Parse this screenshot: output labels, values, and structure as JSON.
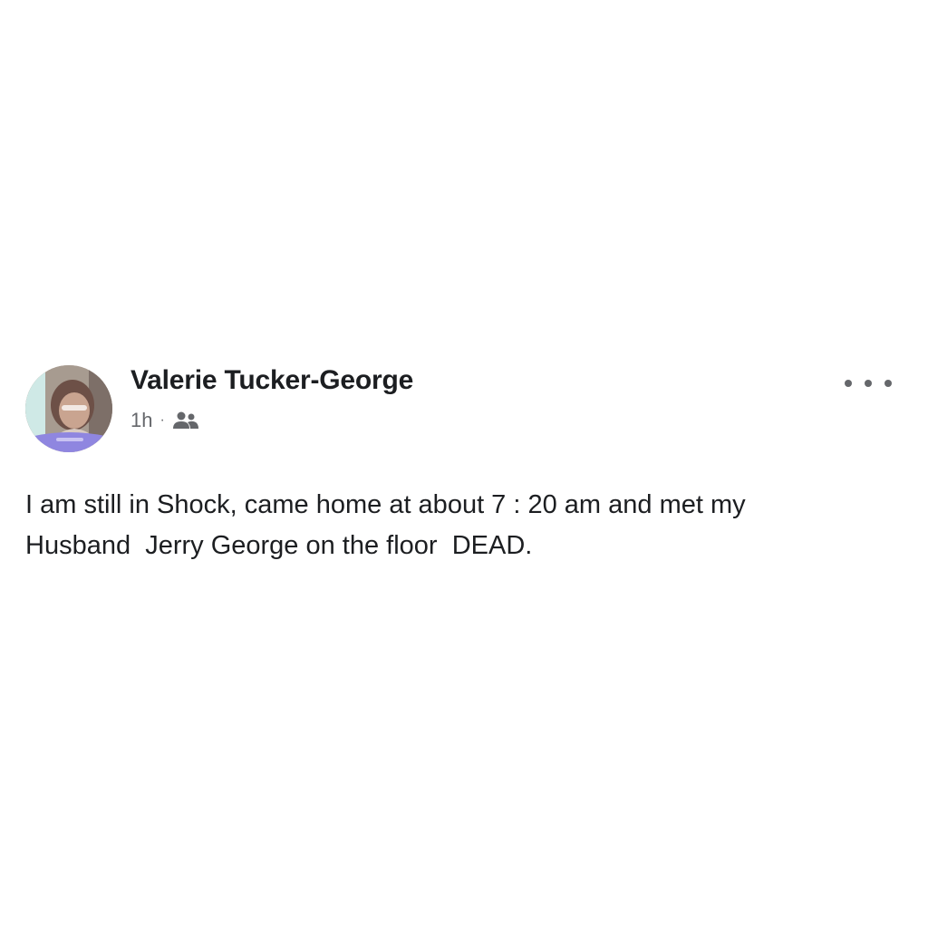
{
  "post": {
    "author": "Valerie Tucker-George",
    "time": "1h",
    "separator": "·",
    "audience_icon": "friends-icon",
    "more_icon": "more-options-icon",
    "text": "I am still in Shock, came home at about 7 : 20 am and met my\nHusband  Jerry George on the floor  DEAD."
  },
  "colors": {
    "text_primary": "#1c1e21",
    "text_secondary": "#65676b",
    "avatar_frame_accent": "#8f86e0",
    "background": "#ffffff"
  }
}
